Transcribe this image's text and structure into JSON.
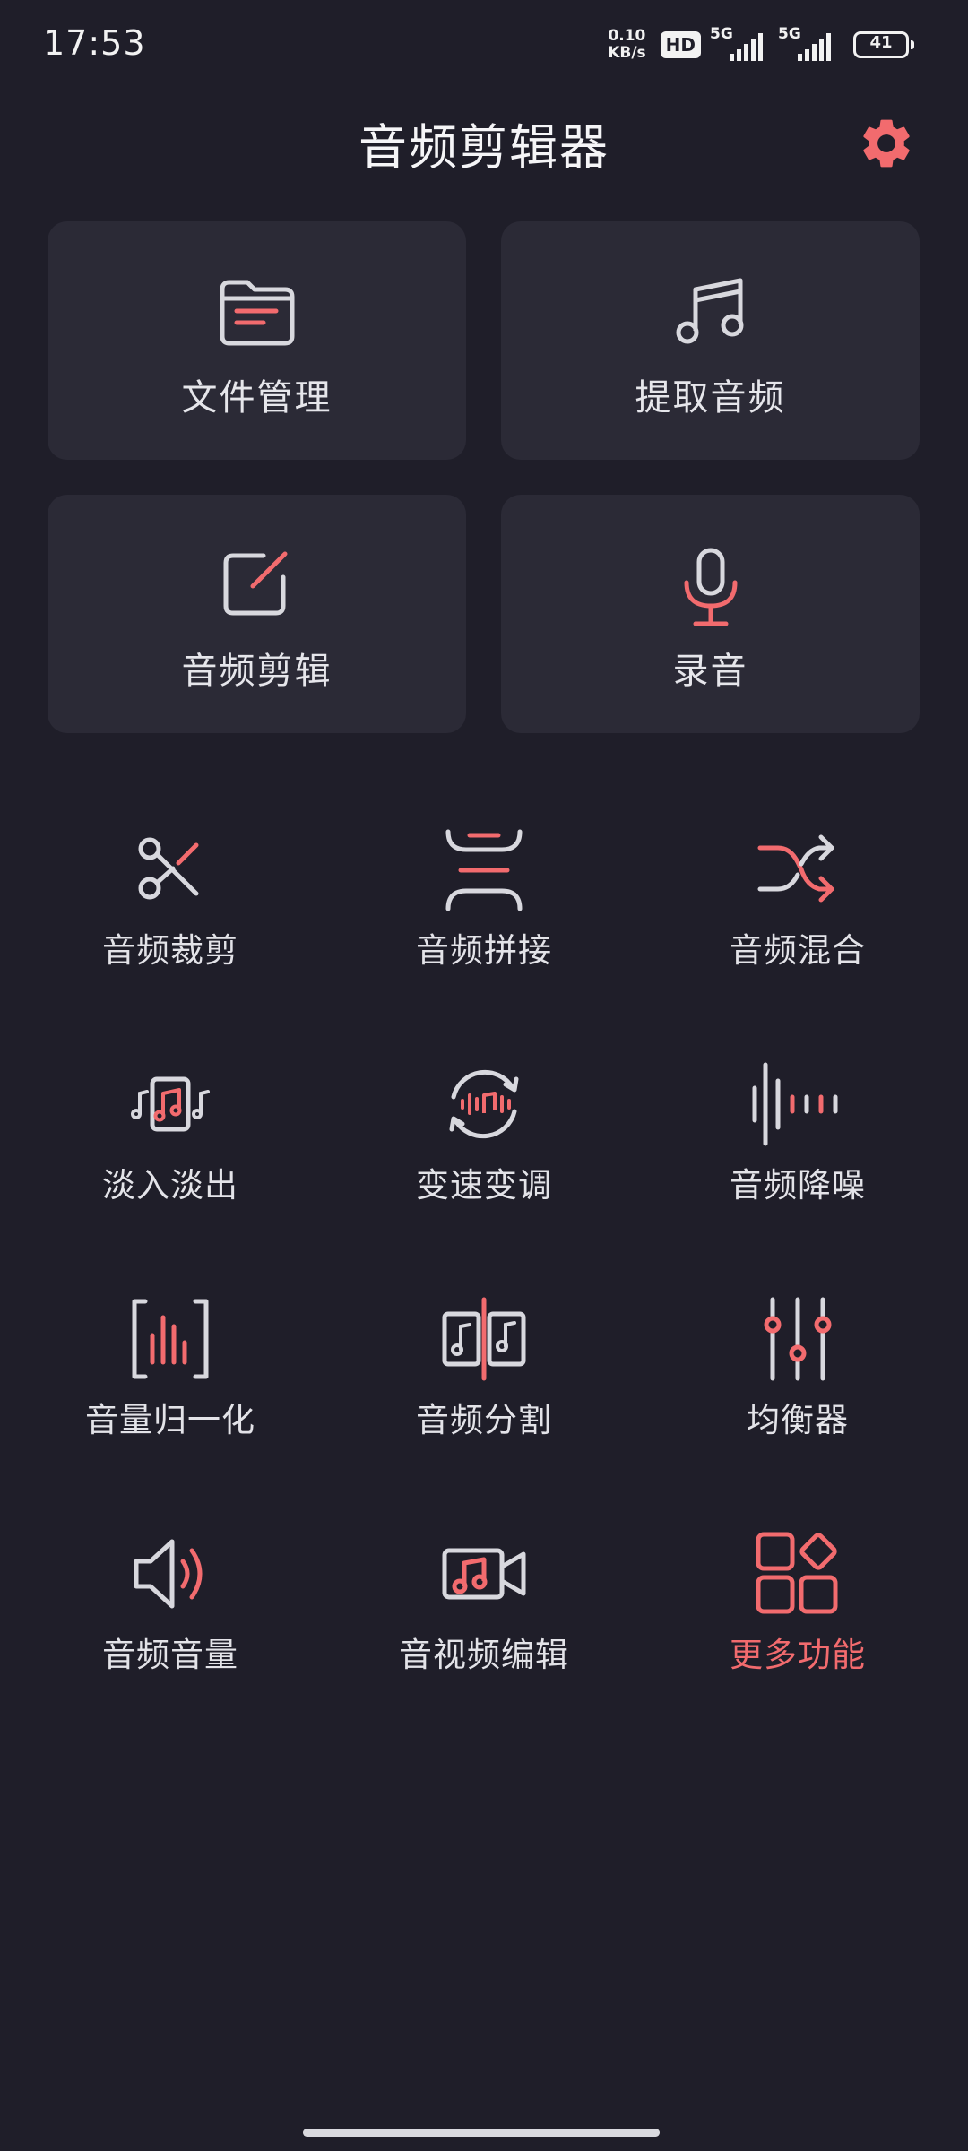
{
  "status_bar": {
    "time": "17:53",
    "net_speed_value": "0.10",
    "net_speed_unit": "KB/s",
    "hd_badge": "HD",
    "signal1_label": "5G",
    "signal2_label": "5G",
    "battery": "41"
  },
  "header": {
    "title": "音频剪辑器",
    "settings_icon": "gear-icon"
  },
  "cards": [
    {
      "label": "文件管理",
      "icon": "folder-icon"
    },
    {
      "label": "提取音频",
      "icon": "music-note-icon"
    },
    {
      "label": "音频剪辑",
      "icon": "edit-icon"
    },
    {
      "label": "录音",
      "icon": "microphone-icon"
    }
  ],
  "tools": [
    {
      "label": "音频裁剪",
      "icon": "scissors-icon"
    },
    {
      "label": "音频拼接",
      "icon": "join-icon"
    },
    {
      "label": "音频混合",
      "icon": "shuffle-icon"
    },
    {
      "label": "淡入淡出",
      "icon": "fade-icon"
    },
    {
      "label": "变速变调",
      "icon": "speed-icon"
    },
    {
      "label": "音频降噪",
      "icon": "denoise-icon"
    },
    {
      "label": "音量归一化",
      "icon": "normalize-icon"
    },
    {
      "label": "音频分割",
      "icon": "split-icon"
    },
    {
      "label": "均衡器",
      "icon": "equalizer-icon"
    },
    {
      "label": "音频音量",
      "icon": "volume-icon"
    },
    {
      "label": "音视频编辑",
      "icon": "video-edit-icon"
    },
    {
      "label": "更多功能",
      "icon": "more-icon"
    }
  ],
  "colors": {
    "background": "#1f1e29",
    "card": "#2b2a36",
    "accent": "#f26b6e",
    "icon_gray": "#d8d8de"
  }
}
